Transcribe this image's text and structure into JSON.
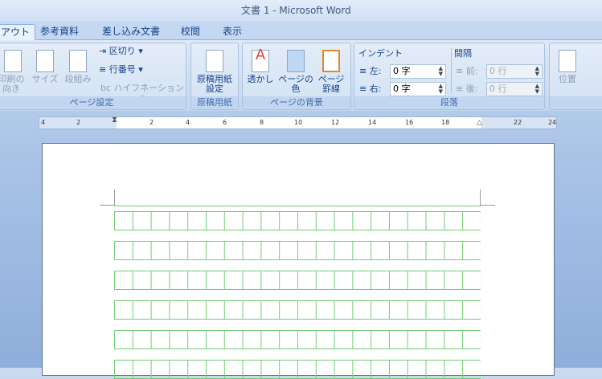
{
  "title": "文書 1 - Microsoft Word",
  "tabs": [
    {
      "label": "アウト"
    },
    {
      "label": "参考資料"
    },
    {
      "label": "差し込み文書"
    },
    {
      "label": "校閲"
    },
    {
      "label": "表示"
    }
  ],
  "page_setup": {
    "label": "ページ設定",
    "orientation": "印刷の向き",
    "size": "サイズ",
    "columns": "段組み",
    "breaks": "区切り",
    "line_numbers": "行番号",
    "hyphenation": "ハイフネーション"
  },
  "genko": {
    "label": "原稿用紙",
    "button": "原稿用紙設定"
  },
  "background": {
    "label": "ページの背景",
    "watermark": "透かし",
    "page_color": "ページの色",
    "page_borders": "ページ罫線"
  },
  "paragraph": {
    "label": "段落",
    "indent": "インデント",
    "left": "左:",
    "right": "右:",
    "left_value": "0 字",
    "right_value": "0 字",
    "spacing": "間隔",
    "before": "前:",
    "after": "後:",
    "before_value": "0 行",
    "after_value": "0 行"
  },
  "arrange": {
    "position": "位置"
  },
  "ruler": {
    "ticks": [
      "4",
      "2",
      "2",
      "4",
      "6",
      "8",
      "10",
      "12",
      "14",
      "16",
      "18",
      "22",
      "24"
    ]
  }
}
